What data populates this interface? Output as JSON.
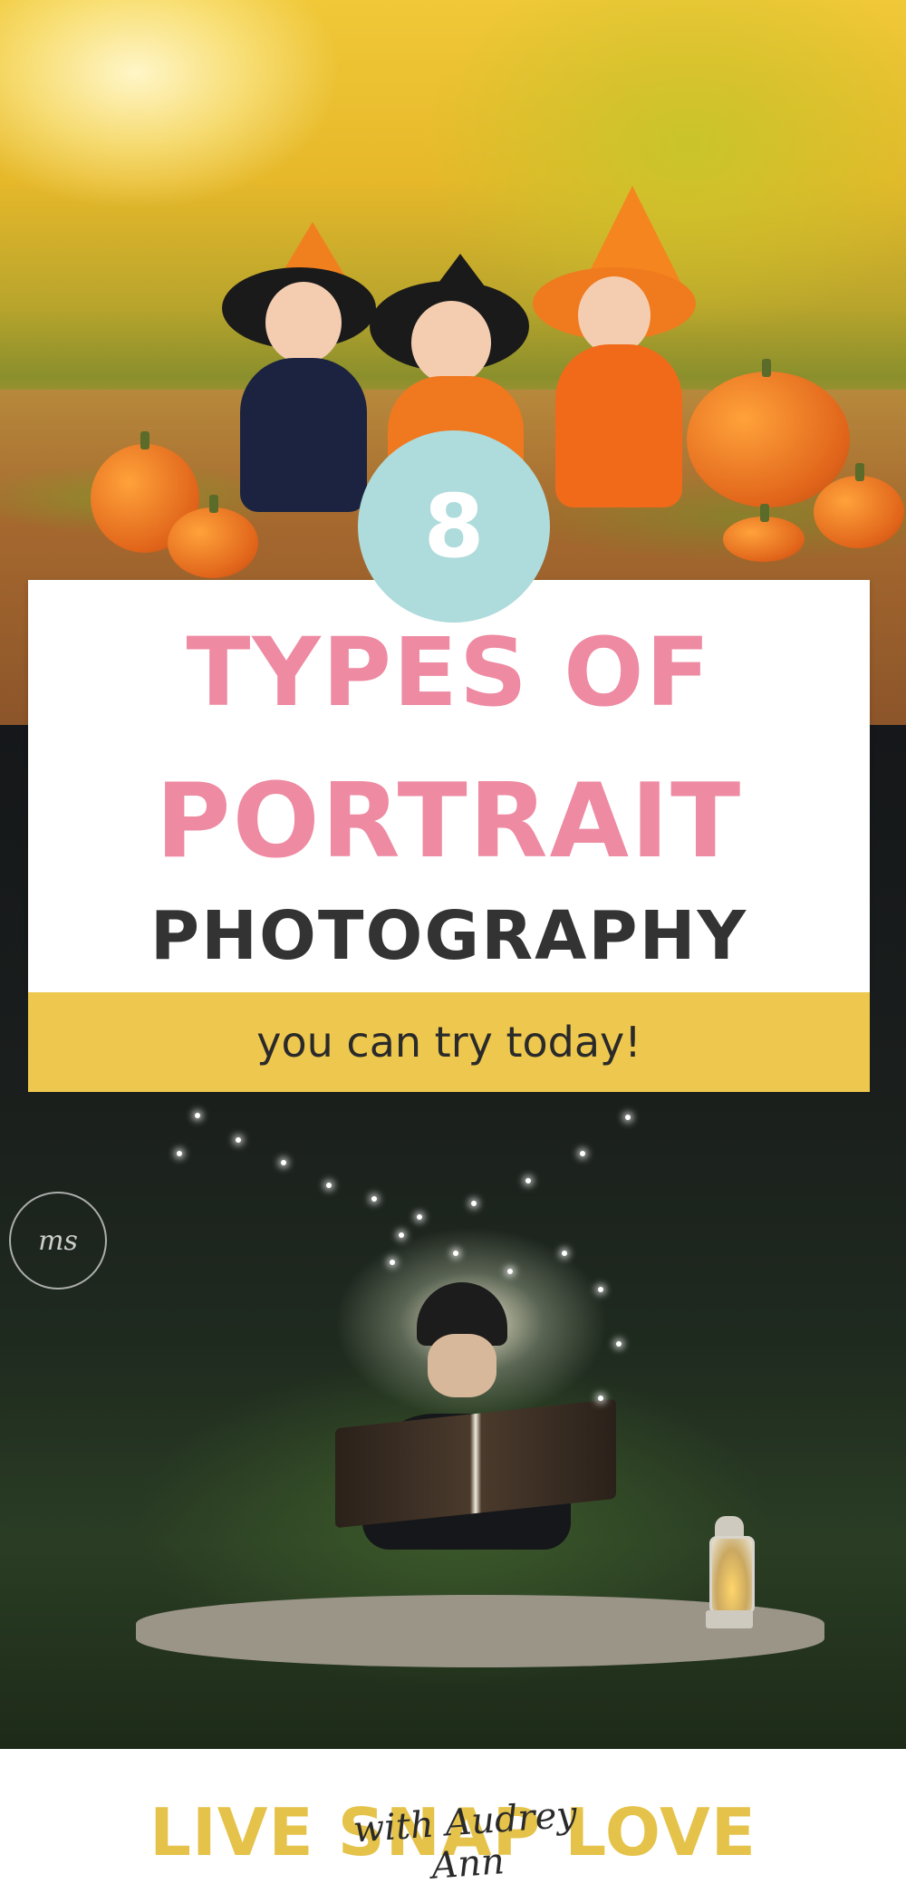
{
  "badge": {
    "number": "8"
  },
  "title": {
    "line1": "TYPES OF",
    "line2": "PORTRAIT",
    "line3": "PHOTOGRAPHY"
  },
  "subtitle": "you can try today!",
  "watermark": {
    "monogram": "ms"
  },
  "footer": {
    "brand": "LIVE SNAP LOVE",
    "script": "with Audrey Ann"
  },
  "colors": {
    "pink": "#ee8aa2",
    "dark": "#333333",
    "yellow_bar": "#eec84e",
    "badge": "#aedbdb",
    "brand_yellow": "#e5c34a"
  }
}
